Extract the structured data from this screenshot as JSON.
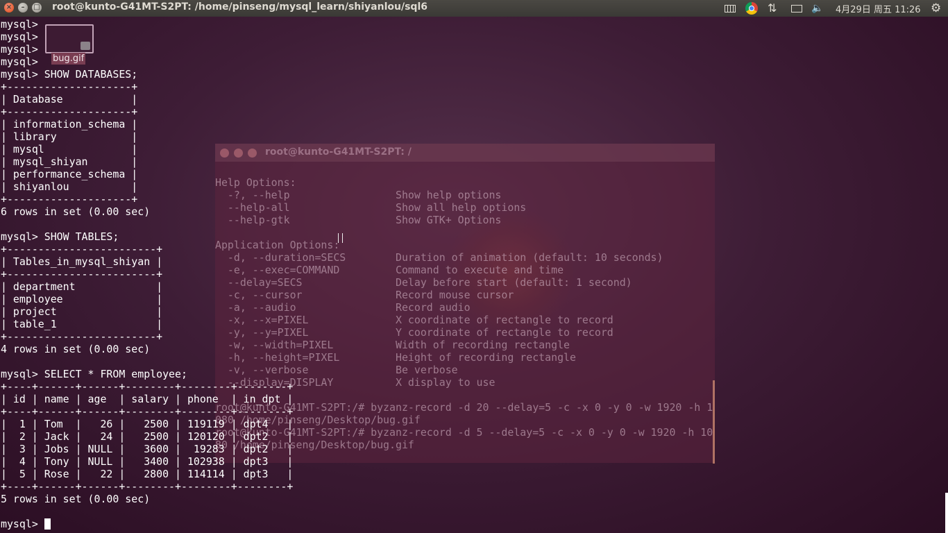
{
  "top_panel": {
    "window_title": "root@kunto-G41MT-S2PT: /home/pinseng/mysql_learn/shiyanlou/sql6",
    "close_glyph": "×",
    "min_glyph": "–",
    "max_glyph": "□",
    "clock": "4月29日 周五 11:26",
    "network_glyph": "⇅",
    "volume_glyph": "🔈",
    "settings_glyph": "⚙",
    "tray_icons": [
      "keyboard-icon",
      "chrome-icon",
      "network-icon",
      "mail-icon",
      "volume-icon",
      "settings-icon"
    ]
  },
  "desktop_file": {
    "label": "bug.gif"
  },
  "terminal_lines": [
    "mysql>",
    "mysql>",
    "mysql>",
    "mysql>",
    "mysql> SHOW DATABASES;",
    "+--------------------+",
    "| Database           |",
    "+--------------------+",
    "| information_schema |",
    "| library            |",
    "| mysql              |",
    "| mysql_shiyan       |",
    "| performance_schema |",
    "| shiyanlou          |",
    "+--------------------+",
    "6 rows in set (0.00 sec)",
    "",
    "mysql> SHOW TABLES;",
    "+------------------------+",
    "| Tables_in_mysql_shiyan |",
    "+------------------------+",
    "| department             |",
    "| employee               |",
    "| project                |",
    "| table_1                |",
    "+------------------------+",
    "4 rows in set (0.00 sec)",
    "",
    "mysql> SELECT * FROM employee;",
    "+----+------+------+--------+--------+--------+",
    "| id | name | age  | salary | phone  | in_dpt |",
    "+----+------+------+--------+--------+--------+",
    "|  1 | Tom  |   26 |   2500 | 119119 | dpt4   |",
    "|  2 | Jack |   24 |   2500 | 120120 | dpt2   |",
    "|  3 | Jobs | NULL |   3600 |  19283 | dpt2   |",
    "|  4 | Tony | NULL |   3400 | 102938 | dpt3   |",
    "|  5 | Rose |   22 |   2800 | 114114 | dpt3   |",
    "+----+------+------+--------+--------+--------+",
    "5 rows in set (0.00 sec)",
    "",
    "mysql> "
  ],
  "ghost_terminal": {
    "title": "root@kunto-G41MT-S2PT: /",
    "lines": [
      "Help Options:",
      "  -?, --help                 Show help options",
      "  --help-all                 Show all help options",
      "  --help-gtk                 Show GTK+ Options",
      "",
      "Application Options:",
      "  -d, --duration=SECS        Duration of animation (default: 10 seconds)",
      "  -e, --exec=COMMAND         Command to execute and time",
      "  --delay=SECS               Delay before start (default: 1 second)",
      "  -c, --cursor               Record mouse cursor",
      "  -a, --audio                Record audio",
      "  -x, --x=PIXEL              X coordinate of rectangle to record",
      "  -y, --y=PIXEL              Y coordinate of rectangle to record",
      "  -w, --width=PIXEL          Width of recording rectangle",
      "  -h, --height=PIXEL         Height of recording rectangle",
      "  -v, --verbose              Be verbose",
      "  --display=DISPLAY          X display to use",
      "",
      "root@kunto-G41MT-S2PT:/# byzanz-record -d 20 --delay=5 -c -x 0 -y 0 -w 1920 -h 1",
      "080 /home/pinseng/Desktop/bug.gif",
      "root@kunto-G41MT-S2PT:/# byzanz-record -d 5 --delay=5 -c -x 0 -y 0 -w 1920 -h 10",
      "80 /home/pinseng/Desktop/bug.gif"
    ]
  }
}
